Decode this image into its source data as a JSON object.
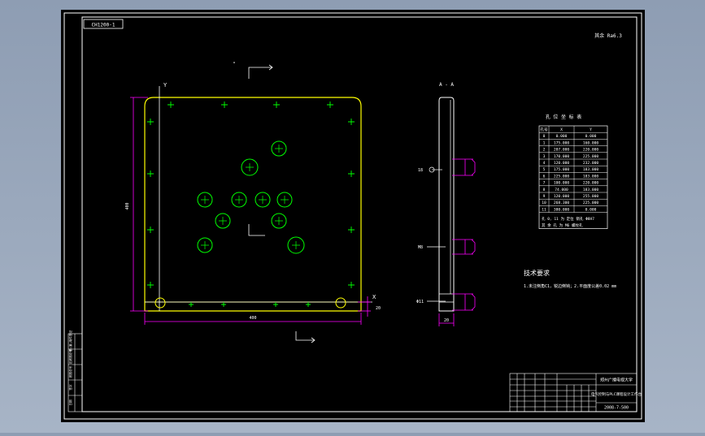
{
  "drawing": {
    "code_box": "CH1200-1",
    "roughness_note": "其余 Ra6.3",
    "section_label": "A - A",
    "axis_labels": {
      "x": "X",
      "y": "Y"
    },
    "dimensions": {
      "width": "400",
      "height": "400",
      "thickness": "20",
      "side_a": "18",
      "side_b": "M8",
      "side_c": "Φ11"
    },
    "hole_table": {
      "title": "孔 位 坐 标 表",
      "headers": [
        "孔号",
        "X",
        "Y"
      ],
      "rows": [
        [
          "0",
          "0.000",
          "0.000"
        ],
        [
          "1",
          "175.000",
          "160.000"
        ],
        [
          "2",
          "207.000",
          "220.000"
        ],
        [
          "3",
          "170.000",
          "225.000"
        ],
        [
          "4",
          "120.000",
          "232.000"
        ],
        [
          "5",
          "175.000",
          "183.000"
        ],
        [
          "6",
          "225.000",
          "183.000"
        ],
        [
          "7",
          "100.000",
          "220.000"
        ],
        [
          "8",
          "74.000",
          "183.000"
        ],
        [
          "9",
          "120.000",
          "255.000"
        ],
        [
          "10",
          "268.300",
          "225.000"
        ],
        [
          "11",
          "380.000",
          "0.000"
        ]
      ],
      "note1": "孔 0, 11 为 定位 销孔 Φ8H7",
      "note2": "其 余 孔 为 M6 螺纹孔"
    },
    "tech_requirements": {
      "title": "技术要求",
      "line": "1.未注倒角C1，锐边倒钝；2.平面度公差0.02 mm"
    },
    "title_block": {
      "school": "郑州广播电视大学",
      "drawing_name": "电气控制与PLC课程设计工作台",
      "drawing_no": "2008-7-500",
      "left_labels": [
        "借(通)用件登记",
        "旧底图总号",
        "底图总号",
        "签字",
        "日期"
      ]
    }
  }
}
